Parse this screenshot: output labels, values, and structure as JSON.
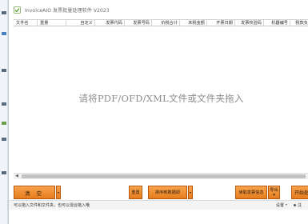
{
  "window": {
    "title": "InvoiceAIO 发票批量处理软件 V2023"
  },
  "grid": {
    "columns": [
      "文件名",
      "重量",
      "自定义",
      "发票代码",
      "发票号码",
      "价税合计",
      "未税金额",
      "开票日期",
      "发票校验码",
      "机器编号",
      "税款负"
    ]
  },
  "drop_area": {
    "hint": "请将PDF/OFD/XML文件或文件夹拖入"
  },
  "toolbar": {
    "clear_label": "清 空",
    "reset_label": "重置",
    "sort_label": "排序到数据即",
    "read_invoice_label": "读取发票信息",
    "export_label_line1": "导出",
    "export_label_line2": "▾",
    "start_label": "开始处理",
    "dropdown_glyph": "▾"
  },
  "status": {
    "text": "可以拖入文件和文件夹，也可以混合拖入哦",
    "settings_label": "设置",
    "settings_dropdown": "▾",
    "note_label": "注"
  },
  "colors": {
    "button_orange": "#f39a3f",
    "button_border": "#b45a12",
    "hint_gray": "#8c8c8c"
  }
}
